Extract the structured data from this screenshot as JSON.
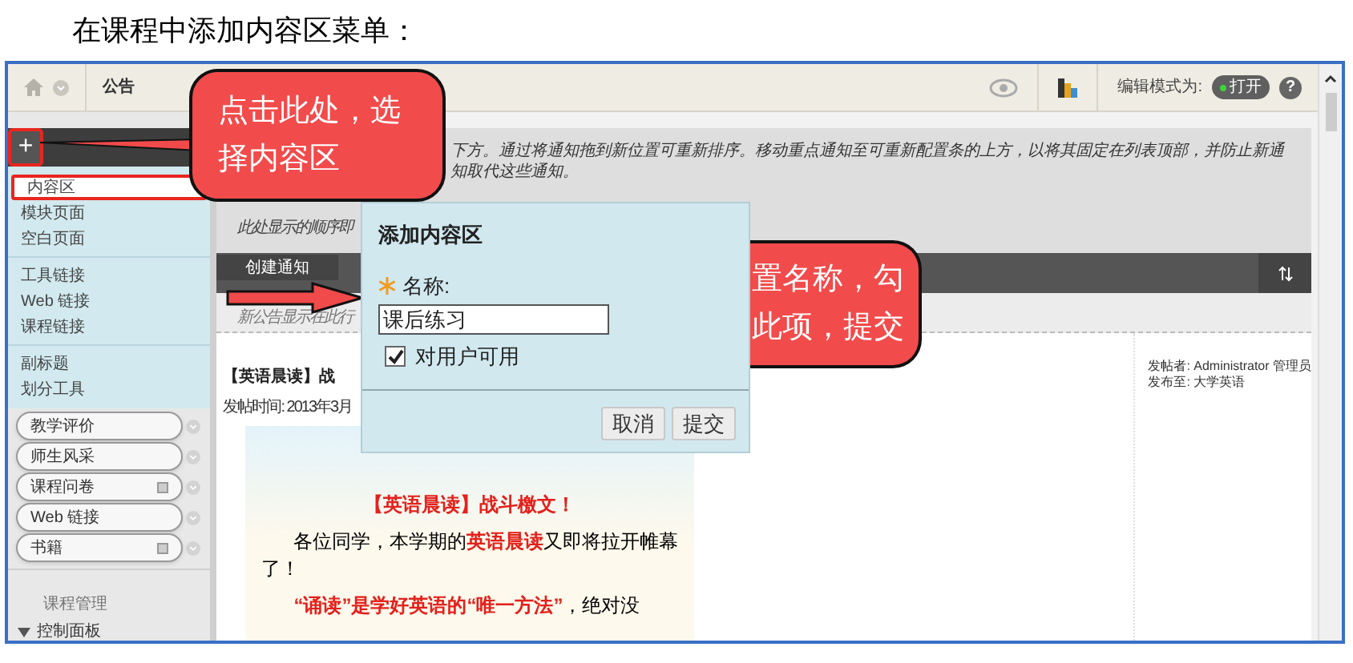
{
  "heading": "在课程中添加内容区菜单：",
  "top_bar": {
    "breadcrumb": "公告",
    "edit_mode_label": "编辑模式为:",
    "edit_mode_toggle": "打开",
    "edit_mode_on": true,
    "help": "?"
  },
  "sidebar": {
    "add_button": {
      "label": "+",
      "highlighted": true
    },
    "add_menu": [
      [
        {
          "label": "内容区",
          "highlighted": true
        },
        {
          "label": "模块页面",
          "highlighted": false
        },
        {
          "label": "空白页面",
          "highlighted": false
        }
      ],
      [
        {
          "label": "工具链接",
          "highlighted": false
        },
        {
          "label": "Web 链接",
          "highlighted": false
        },
        {
          "label": "课程链接",
          "highlighted": false
        }
      ],
      [
        {
          "label": "副标题",
          "highlighted": false
        },
        {
          "label": "划分工具",
          "highlighted": false
        }
      ]
    ],
    "menu_items": [
      {
        "label": "教学评价",
        "hidden_mark": false
      },
      {
        "label": "师生风采",
        "hidden_mark": false
      },
      {
        "label": "课程问卷",
        "hidden_mark": true
      },
      {
        "label": "Web 链接",
        "hidden_mark": false
      },
      {
        "label": "书籍",
        "hidden_mark": true
      }
    ],
    "section": "课程管理",
    "panel": {
      "label": "控制面板",
      "expanded": true
    }
  },
  "content": {
    "instructions": [
      "下方。通过将通知拖到新位置可重新排序。移动重点通知至可重新配置条的上方，以将其固定在列表顶部，并防止新通知取代这些通知。",
      "此处显示的顺序即"
    ],
    "create_button": "创建通知",
    "new_notice_hint": "新公告显示在此行",
    "post": {
      "title": "【英语晨读】战",
      "date": "发帖时间: 2013年3月",
      "banner_title": "【英语晨读】战斗檄文！",
      "paragraphs": [
        "各位同学，本学期的**英语晨读**又即将拉开帷幕了！",
        "**“诵读”是学好英语的“唯一方法”**，绝对没"
      ]
    },
    "meta": [
      "发帖者: Administrator 管理员",
      "发布至: 大学英语"
    ]
  },
  "dialog": {
    "title": "添加内容区",
    "field_label": "名称:",
    "required": true,
    "value": "课后练习",
    "checkbox": {
      "label": "对用户可用",
      "checked": true
    },
    "buttons": [
      "取消",
      "提交"
    ]
  },
  "callouts": [
    {
      "lines": [
        "点击此处，选",
        "择内容区"
      ]
    },
    {
      "lines": [
        "置名称，勾",
        "此项，提交"
      ]
    }
  ]
}
